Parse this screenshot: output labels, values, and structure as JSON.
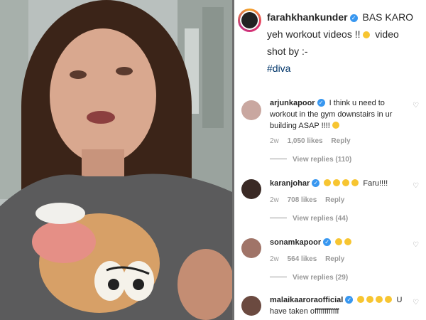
{
  "post": {
    "author": "farahkhankunder",
    "caption_1": "BAS KARO yeh workout videos !!",
    "caption_2": "video shot by :-",
    "hashtag": "#diva"
  },
  "comments": [
    {
      "user": "arjunkapoor",
      "text": "I think u need to workout in the gym downstairs in ur building ASAP !!!!",
      "time": "2w",
      "likes": "1,050 likes",
      "reply": "Reply",
      "view_replies": "View replies (110)"
    },
    {
      "user": "karanjohar",
      "text": "Faru!!!!",
      "time": "2w",
      "likes": "708 likes",
      "reply": "Reply",
      "view_replies": "View replies (44)"
    },
    {
      "user": "sonamkapoor",
      "text": "",
      "time": "2w",
      "likes": "564 likes",
      "reply": "Reply",
      "view_replies": "View replies (29)"
    },
    {
      "user": "malaikaaroraofficial",
      "text": "U have taken offffffffffff"
    }
  ],
  "icons": {
    "verified": "verified-badge-icon",
    "heart": "heart-outline-icon",
    "emoji": "emoji-icon"
  },
  "colors": {
    "verified": "#3897f0",
    "text": "#262626",
    "muted": "#999999",
    "hashtag": "#003569"
  }
}
